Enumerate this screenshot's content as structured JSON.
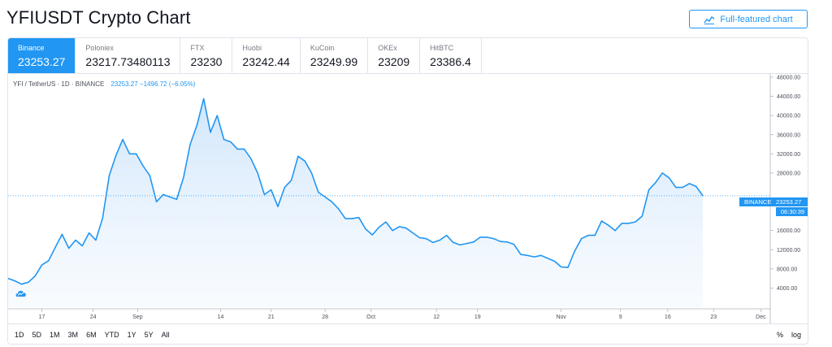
{
  "page": {
    "title": "YFIUSDT Crypto Chart",
    "full_chart_button": "Full-featured chart"
  },
  "tabs": [
    {
      "exchange": "Binance",
      "price": "23253.27",
      "active": true
    },
    {
      "exchange": "Poloniex",
      "price": "23217.73480113",
      "active": false
    },
    {
      "exchange": "FTX",
      "price": "23230",
      "active": false
    },
    {
      "exchange": "Huobi",
      "price": "23242.44",
      "active": false
    },
    {
      "exchange": "KuCoin",
      "price": "23249.99",
      "active": false
    },
    {
      "exchange": "OKEx",
      "price": "23209",
      "active": false
    },
    {
      "exchange": "HitBTC",
      "price": "23386.4",
      "active": false
    }
  ],
  "legend": {
    "symbol": "YFI / TetherUS · 1D · BINANCE",
    "values": "23253.27  −1496.72 (−6.05%)"
  },
  "price_badge": {
    "name": "BINANCE",
    "value": "23253.27",
    "timer": "06:30:39"
  },
  "ranges": [
    "1D",
    "5D",
    "1M",
    "3M",
    "6M",
    "YTD",
    "1Y",
    "5Y",
    "All"
  ],
  "toggles": {
    "percent": "%",
    "log": "log"
  },
  "colors": {
    "accent": "#2196f3",
    "area_top": "#cfe5fb",
    "area_bottom": "#f4f9fe"
  },
  "chart_data": {
    "type": "area",
    "series": [
      {
        "values": [
          6000,
          5500,
          4800,
          5200,
          6500,
          8800,
          9700,
          12500,
          15200,
          12300,
          14000,
          12800,
          15500,
          14000,
          18500,
          27500,
          31700,
          35000,
          32000,
          32000,
          29500,
          27500,
          22000,
          23500,
          23000,
          22500,
          27000,
          34000,
          38000,
          43500,
          36500,
          40000,
          35000,
          34500,
          33000,
          33000,
          31000,
          28000,
          23500,
          24500,
          21000,
          25000,
          26500,
          31500,
          30500,
          28000,
          24000,
          23000,
          22000,
          20500,
          18500,
          18500,
          18700,
          16300,
          15100,
          16700,
          17800,
          16000,
          16800,
          16500,
          15500,
          14500,
          14300,
          13500,
          14000,
          15000,
          13500,
          13000,
          13300,
          13600,
          14600,
          14600,
          14300,
          13700,
          13600,
          13100,
          11000,
          10800,
          10500,
          10800,
          10200,
          9600,
          8400,
          8300,
          11700,
          14300,
          15000,
          15000,
          18000,
          17100,
          16000,
          17500,
          17500,
          17800,
          19000,
          24500,
          26000,
          28000,
          27000,
          25000,
          25000,
          25800,
          25200,
          23253
        ]
      }
    ],
    "x_tick_labels": [
      "17",
      "24",
      "Sep",
      "14",
      "21",
      "28",
      "Oct",
      "12",
      "19",
      "Nov",
      "9",
      "16",
      "23",
      "Dec"
    ],
    "y_tick_labels": [
      "48000.00",
      "44000.00",
      "40000.00",
      "36000.00",
      "32000.00",
      "28000.00",
      "16000.00",
      "12000.00",
      "8000.00",
      "4000.00"
    ],
    "ylim": [
      0,
      48000
    ],
    "last_value": 23253.27,
    "grid": false
  }
}
